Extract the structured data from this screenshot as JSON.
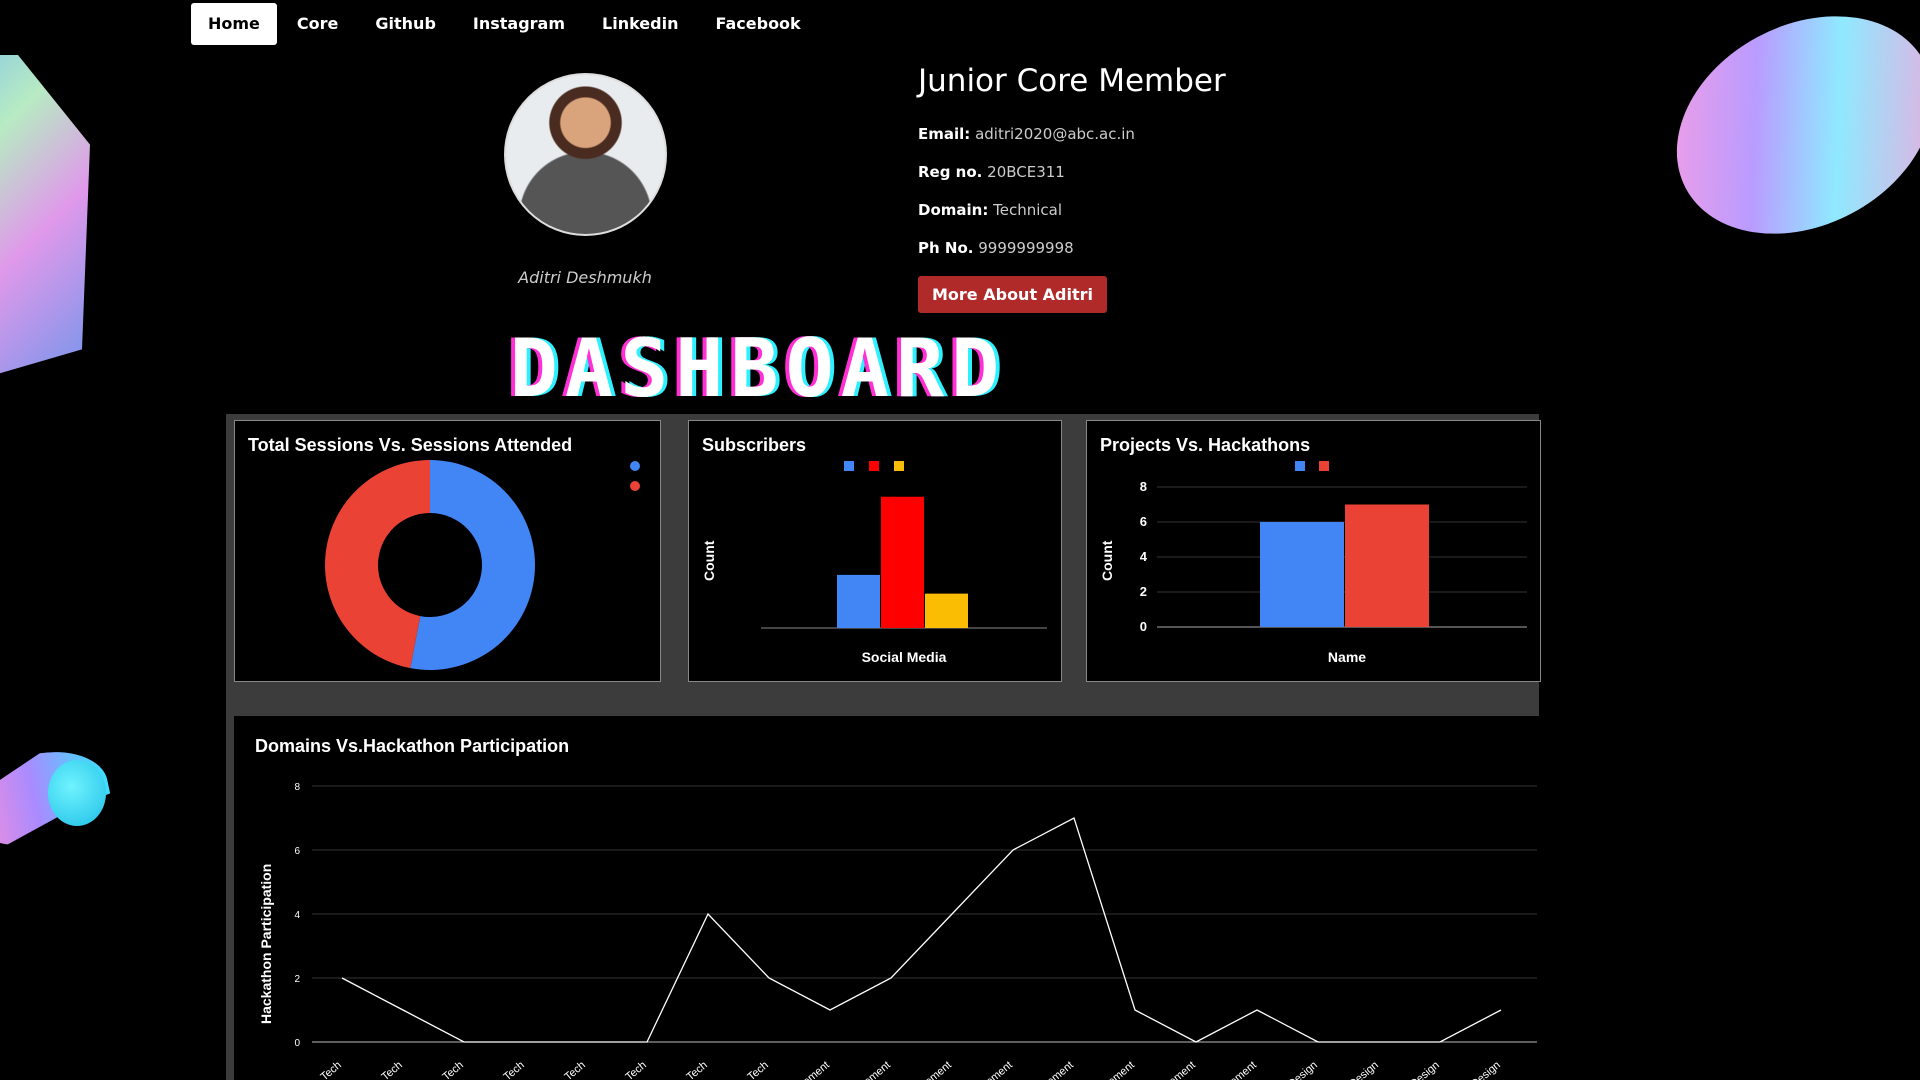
{
  "nav": {
    "items": [
      {
        "label": "Home",
        "active": true
      },
      {
        "label": "Core",
        "active": false
      },
      {
        "label": "Github",
        "active": false
      },
      {
        "label": "Instagram",
        "active": false
      },
      {
        "label": "Linkedin",
        "active": false
      },
      {
        "label": "Facebook",
        "active": false
      }
    ]
  },
  "profile": {
    "name": "Aditri Deshmukh",
    "role": "Junior Core Member",
    "email_label": "Email:",
    "email": "aditri2020@abc.ac.in",
    "reg_label": "Reg no.",
    "reg": "20BCE311",
    "domain_label": "Domain:",
    "domain": "Technical",
    "phone_label": "Ph No.",
    "phone": "9999999998",
    "more_button": "More About Aditri"
  },
  "dashboard_title": "DASHBOARD",
  "colors": {
    "blue": "#4285f4",
    "red": "#ea4335",
    "bright_red": "#ff0000",
    "yellow": "#fbbc04",
    "accent_button": "#b02a2a"
  },
  "chart_data": [
    {
      "type": "pie",
      "title": "Total Sessions Vs. Sessions Attended",
      "donut": true,
      "values": [
        53,
        47
      ],
      "colors": [
        "#4285f4",
        "#ea4335"
      ],
      "legend": "top-right"
    },
    {
      "type": "bar",
      "title": "Subscribers",
      "xlabel": "Social Media",
      "ylabel": "Count",
      "values": [
        8.5,
        21,
        5.5
      ],
      "colors": [
        "#4285f4",
        "#ff0000",
        "#fbbc04"
      ],
      "ylim": [
        0,
        24
      ],
      "legend": "top"
    },
    {
      "type": "bar",
      "title": "Projects Vs. Hackathons",
      "xlabel": "Name",
      "ylabel": "Count",
      "values": [
        6,
        7
      ],
      "colors": [
        "#4285f4",
        "#ea4335"
      ],
      "yticks": [
        0,
        2,
        4,
        6,
        8
      ],
      "ylim": [
        0,
        8
      ],
      "legend": "top"
    },
    {
      "type": "line",
      "title": "Domains Vs.Hackathon Participation",
      "ylabel": "Hackathon Participation",
      "categories": [
        "Tech",
        "Tech",
        "Tech",
        "Tech",
        "Tech",
        "Tech",
        "Tech",
        "Tech",
        "Management",
        "Management",
        "Management",
        "Management",
        "Management",
        "Management",
        "Management",
        "Management",
        "Design",
        "Design",
        "Design",
        "Design"
      ],
      "values": [
        2,
        1,
        0,
        0,
        0,
        0,
        4,
        2,
        1,
        2,
        4,
        6,
        7,
        1,
        0,
        1,
        0,
        0,
        0,
        1
      ],
      "yticks": [
        0,
        2,
        4,
        6,
        8
      ],
      "ylim": [
        0,
        8
      ],
      "grid": true,
      "line_color": "#ffffff"
    }
  ]
}
